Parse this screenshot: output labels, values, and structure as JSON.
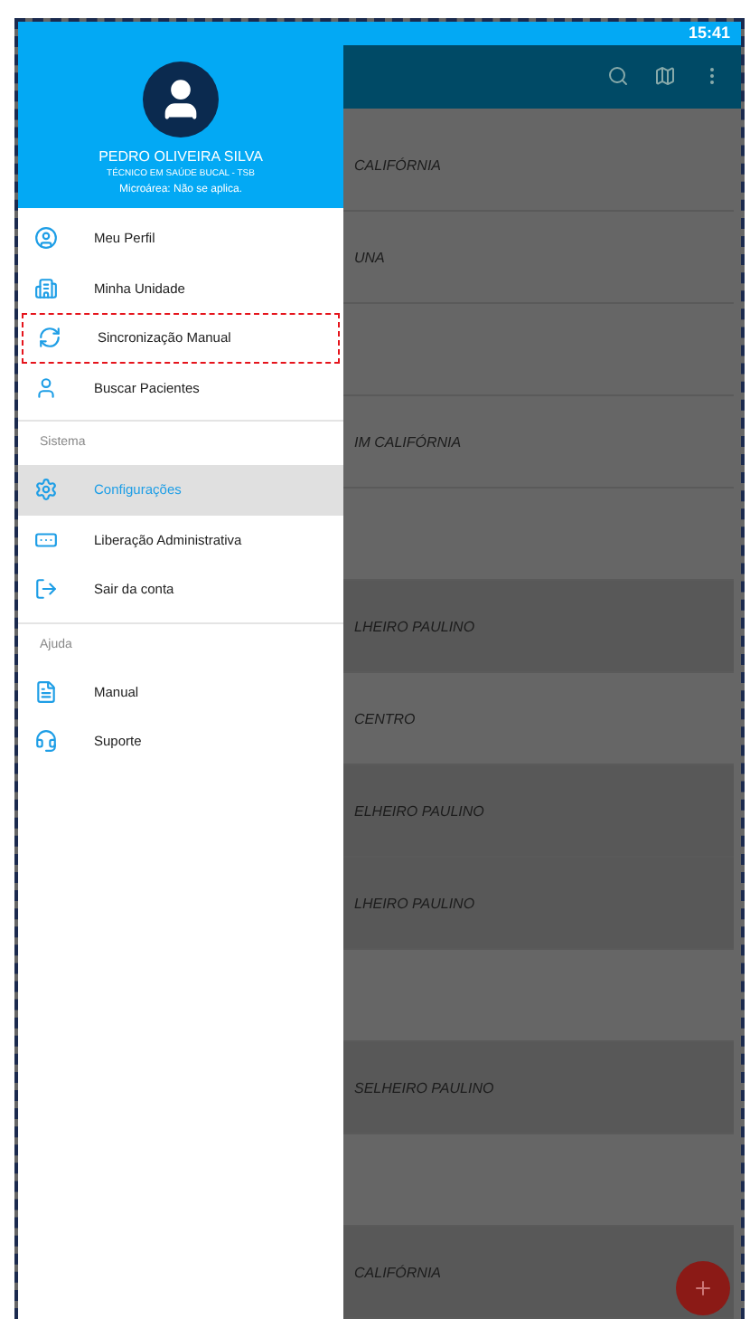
{
  "status_bar": {
    "time": "15:41"
  },
  "list": [
    {
      "text": "CALIFÓRNIA",
      "shaded": false
    },
    {
      "text": "UNA",
      "shaded": false
    },
    {
      "shaded": false
    },
    {
      "text": "IM CALIFÓRNIA",
      "shaded": false
    },
    {
      "shaded": false
    },
    {
      "text": "LHEIRO PAULINO",
      "shaded": true
    },
    {
      "text": "CENTRO",
      "shaded": false
    },
    {
      "text": "ELHEIRO PAULINO",
      "shaded": true
    },
    {
      "text": "LHEIRO PAULINO",
      "shaded": true
    },
    {
      "shaded": false
    },
    {
      "text": "SELHEIRO PAULINO",
      "shaded": true
    },
    {
      "shaded": false
    },
    {
      "text": "CALIFÓRNIA",
      "shaded": true
    }
  ],
  "drawer": {
    "user": {
      "name": "PEDRO OLIVEIRA SILVA",
      "role": "TÉCNICO EM SAÚDE BUCAL - TSB",
      "area": "Microárea: Não se aplica."
    },
    "sections": [
      {
        "items": [
          {
            "label": "Meu Perfil",
            "selected": false,
            "highlighted": false
          },
          {
            "label": "Minha Unidade",
            "selected": false,
            "highlighted": false
          },
          {
            "label": "Sincronização Manual",
            "selected": false,
            "highlighted": true
          },
          {
            "label": "Buscar Pacientes",
            "selected": false,
            "highlighted": false
          }
        ]
      },
      {
        "title": "Sistema",
        "items": [
          {
            "label": "Configurações",
            "selected": true,
            "highlighted": false
          },
          {
            "label": "Liberação Administrativa",
            "selected": false,
            "highlighted": false
          },
          {
            "label": "Sair da conta",
            "selected": false,
            "highlighted": false
          }
        ]
      },
      {
        "title": "Ajuda",
        "items": [
          {
            "label": "Manual",
            "selected": false,
            "highlighted": false
          },
          {
            "label": "Suporte",
            "selected": false,
            "highlighted": false
          }
        ]
      }
    ]
  }
}
